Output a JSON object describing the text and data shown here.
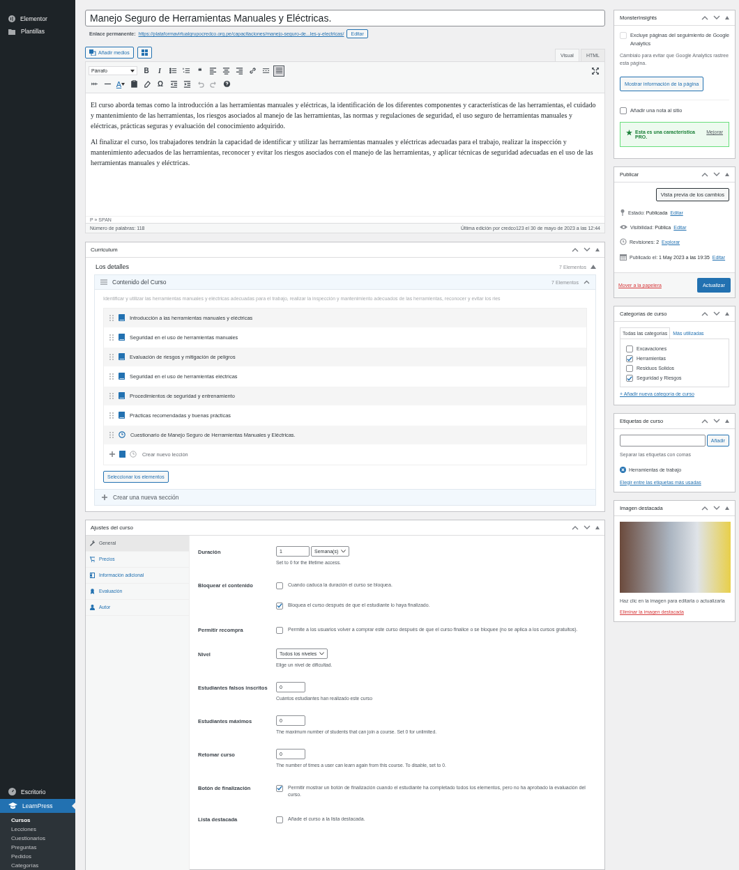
{
  "sidebar": {
    "top_items": [
      {
        "label": "Elementor"
      },
      {
        "label": "Plantillas"
      }
    ],
    "bottom_items": [
      {
        "label": "Escritorio",
        "selected": false
      },
      {
        "label": "LearnPress",
        "selected": true
      }
    ],
    "submenu": [
      {
        "label": "Cursos",
        "selected": true
      },
      {
        "label": "Lecciones",
        "selected": false
      },
      {
        "label": "Cuestionarios",
        "selected": false
      },
      {
        "label": "Preguntas",
        "selected": false
      },
      {
        "label": "Pedidos",
        "selected": false
      },
      {
        "label": "Categorías",
        "selected": false
      }
    ]
  },
  "post": {
    "title": "Manejo Seguro de Herramientas Manuales y Eléctricas.",
    "permalink_label": "Enlace permanente:",
    "permalink_url": "https://plataformavirtualgrupocredco.org.pe/capacitaciones/manejo-seguro-de...les-y-electricas/",
    "permalink_edit": "Editar"
  },
  "editor": {
    "add_media": "Añadir medios",
    "tabs": [
      {
        "label": "Visual",
        "selected": true
      },
      {
        "label": "HTML",
        "selected": false
      }
    ],
    "toolbar_rows": [
      [
        {
          "kind": "select",
          "text": "Párrafo"
        },
        {
          "kind": "glyph",
          "text": "B"
        },
        {
          "kind": "glyph",
          "text": "I"
        },
        {
          "kind": "bullets"
        },
        {
          "kind": "numbers"
        },
        {
          "kind": "glyph",
          "text": "❝"
        },
        {
          "kind": "alignleft"
        },
        {
          "kind": "aligncenter"
        },
        {
          "kind": "alignright"
        },
        {
          "kind": "link"
        },
        {
          "kind": "more"
        },
        {
          "kind": "toggle"
        }
      ],
      [
        {
          "kind": "strike"
        },
        {
          "kind": "rule"
        },
        {
          "kind": "color",
          "text": "A"
        },
        {
          "kind": "paste"
        },
        {
          "kind": "eraser"
        },
        {
          "kind": "glyph",
          "text": "Ω"
        },
        {
          "kind": "outdent"
        },
        {
          "kind": "indent"
        },
        {
          "kind": "undo"
        },
        {
          "kind": "redo"
        },
        {
          "kind": "help"
        }
      ]
    ],
    "paragraphs": [
      "El curso aborda temas como la introducción a las herramientas manuales y eléctricas, la identificación de los diferentes componentes y características de las herramientas, el cuidado y mantenimiento de las herramientas, los riesgos asociados al manejo de las herramientas, las normas y regulaciones de seguridad, el uso seguro de herramientas manuales y eléctricas, prácticas seguras y evaluación del conocimiento adquirido.",
      "Al finalizar el curso, los trabajadores tendrán la capacidad de identificar y utilizar las herramientas manuales y eléctricas adecuadas para el trabajo, realizar la inspección y mantenimiento adecuados de las herramientas, reconocer y evitar los riesgos asociados con el manejo de las herramientas, y aplicar técnicas de seguridad adecuadas en el uso de las herramientas manuales y eléctricas."
    ],
    "path": "P » SPAN",
    "word_count": "Número de palabras: 118",
    "last_edit": "Última edición por credco123 el 30 de mayo de 2023 a las 12:44"
  },
  "curriculum": {
    "title": "Curriculum",
    "details_title": "Los detalles",
    "details_count": "7 Elementos",
    "section": {
      "title": "Contenido del Curso",
      "count": "7 Elementos",
      "description": "Identificar y utilizar las herramientas manuales y eléctricas adecuadas para el trabajo, realizar la inspección y mantenimiento adecuados de las herramientas, reconocer y evitar los ries",
      "items": [
        {
          "kind": "lesson",
          "title": "Introducción a las herramientas manuales y eléctricas"
        },
        {
          "kind": "lesson",
          "title": "Seguridad en el uso de herramientas manuales"
        },
        {
          "kind": "lesson",
          "title": "Evaluación de riesgos y mitigación de peligros"
        },
        {
          "kind": "lesson",
          "title": "Seguridad en el uso de herramientas eléctricas"
        },
        {
          "kind": "lesson",
          "title": "Procedimientos de seguridad y entrenamiento"
        },
        {
          "kind": "lesson",
          "title": "Prácticas recomendadas y buenas prácticas"
        },
        {
          "kind": "quiz",
          "title": "Cuestionario de Manejo Seguro de Herramientas Manuales y Eléctricas."
        }
      ],
      "new_item_placeholder": "Crear nuevo lección",
      "select_button": "Seleccionar los elementos"
    },
    "new_section": "Crear una nueva sección"
  },
  "settings": {
    "title": "Ajustes del curso",
    "tabs": [
      {
        "label": "General",
        "selected": true
      },
      {
        "label": "Precios",
        "selected": false
      },
      {
        "label": "Información adicional",
        "selected": false
      },
      {
        "label": "Evaluación",
        "selected": false
      },
      {
        "label": "Autor",
        "selected": false
      }
    ],
    "fields": [
      {
        "kind": "duration",
        "label": "Duración",
        "value": "1",
        "unit": "Semana(s)",
        "help": "Set to 0 for the lifetime access."
      },
      {
        "kind": "checks",
        "label": "Bloquear el contenido",
        "options": [
          {
            "text": "Cuando caduca la duración el curso se bloquea.",
            "checked": false
          },
          {
            "text": "Bloquea el curso después de que el estudiante lo haya finalizado.",
            "checked": true
          }
        ]
      },
      {
        "kind": "checks",
        "label": "Permitir recompra",
        "options": [
          {
            "text": "Permite a los usuarios volver a comprar este curso después de que el curso finalice o se bloquee (no se aplica a los cursos gratuitos).",
            "checked": false
          }
        ]
      },
      {
        "kind": "select",
        "label": "Nivel",
        "value": "Todos los niveles",
        "help": "Elige un nivel de dificultad."
      },
      {
        "kind": "number",
        "label": "Estudiantes falsos inscritos",
        "value": "0",
        "help": "Cuántos estudiantes han realizado este curso"
      },
      {
        "kind": "number",
        "label": "Estudiantes máximos",
        "value": "0",
        "help": "The maximum number of students that can join a course. Set 0 for unlimited."
      },
      {
        "kind": "number",
        "label": "Retomar curso",
        "value": "0",
        "help": "The number of times a user can learn again from this course. To disable, set to 0."
      },
      {
        "kind": "checks",
        "label": "Botón de finalización",
        "options": [
          {
            "text": "Permitir mostrar un botón de finalización cuando el estudiante ha completado todos los elementos, pero no ha aprobado la evaluación del curso.",
            "checked": true
          }
        ]
      },
      {
        "kind": "checks",
        "label": "Lista destacada",
        "options": [
          {
            "text": "Añade el curso a la lista destacada.",
            "checked": false
          }
        ]
      }
    ]
  },
  "monsterinsights": {
    "title": "MonsterInsights",
    "exclude_label": "Excluye páginas del seguimiento de Google Analytics",
    "exclude_checked": false,
    "exclude_help": "Cámbialo para evitar que Google Analytics rastree esta página.",
    "info_button": "Mostrar información de la página",
    "note_label": "Añadir una nota al sitio",
    "note_checked": false,
    "pro_text": "Esta es una característica PRO.",
    "pro_link": "Mejorar"
  },
  "publish": {
    "title": "Publicar",
    "preview_button": "Vista previa de los cambios",
    "rows": [
      {
        "kind": "status",
        "label": "Estado:",
        "value": "Publicada",
        "link": "Editar"
      },
      {
        "kind": "visibility",
        "label": "Visibilidad:",
        "value": "Pública",
        "link": "Editar"
      },
      {
        "kind": "revisions",
        "label": "Revisiones:",
        "value": "2",
        "link": "Explorar"
      },
      {
        "kind": "date",
        "label": "Publicado el:",
        "value": "1 May 2023 a las 19:35",
        "link": "Editar"
      }
    ],
    "trash_link": "Mover a la papelera",
    "update_button": "Actualizar"
  },
  "categories": {
    "title": "Categorías de curso",
    "tabs": [
      {
        "label": "Todas las categorías",
        "selected": true
      },
      {
        "label": "Más utilizadas",
        "selected": false
      }
    ],
    "items": [
      {
        "label": "Excavaciones",
        "checked": false
      },
      {
        "label": "Herramientas",
        "checked": true
      },
      {
        "label": "Residuos Solidos",
        "checked": false
      },
      {
        "label": "Seguridad y Riesgos",
        "checked": true
      }
    ],
    "add_link": "+ Añadir nueva categoría de curso"
  },
  "tags": {
    "title": "Etiquetas de curso",
    "add_button": "Añadir",
    "help": "Separar las etiquetas con comas",
    "items": [
      "Herramientas de trabajo"
    ],
    "choose_link": "Elegir entre las etiquetas más usadas"
  },
  "featured_image": {
    "title": "Imagen destacada",
    "help": "Haz clic en la imagen para editarla o actualizarla",
    "remove_link": "Eliminar la imagen destacada"
  }
}
